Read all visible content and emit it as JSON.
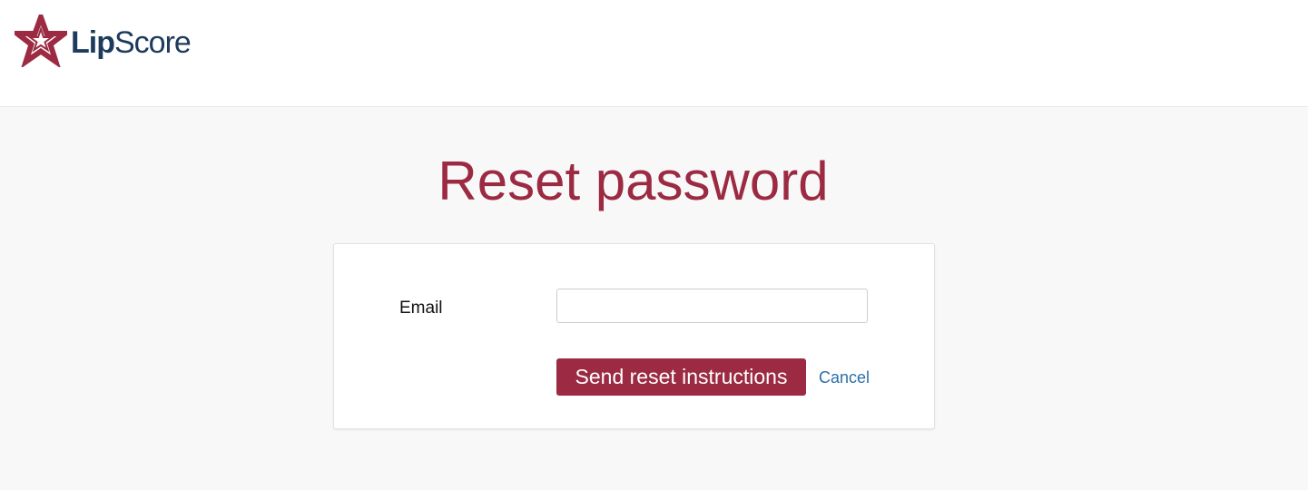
{
  "header": {
    "logo": {
      "text_bold": "Lip",
      "text_regular": "Score",
      "icon": "star-icon",
      "icon_color": "#9b2a42",
      "text_color": "#1d3b5c"
    }
  },
  "main": {
    "title": "Reset password",
    "form": {
      "email_label": "Email",
      "email_value": "",
      "email_placeholder": "",
      "submit_label": "Send reset instructions",
      "cancel_label": "Cancel"
    }
  },
  "colors": {
    "accent": "#9b2a42",
    "link": "#2a6fa8",
    "background": "#f8f8f8"
  }
}
